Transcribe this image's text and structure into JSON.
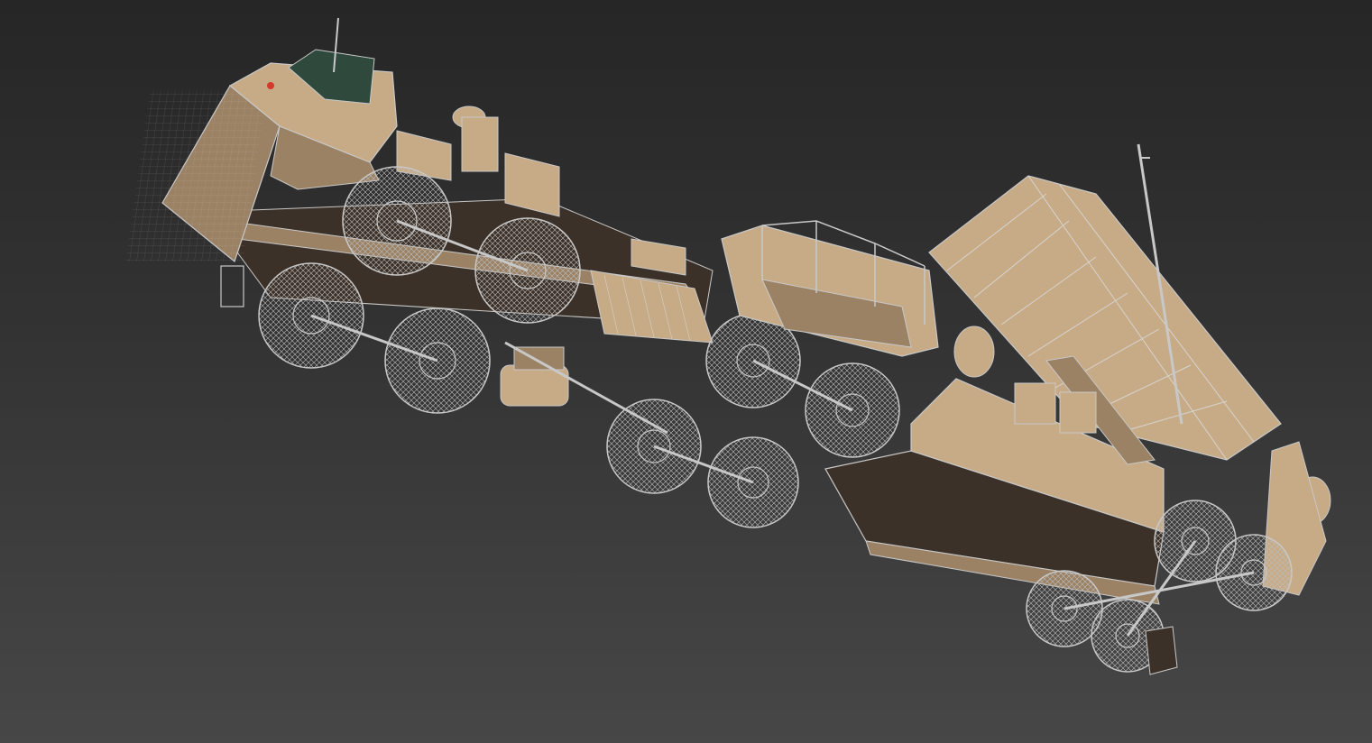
{
  "viewport": {
    "background_top": "#262626",
    "background_bottom": "#474747"
  },
  "model": {
    "wire_color": "#c8c8c8",
    "wire_color_dark": "#9a9a9a",
    "body_color": "#c7ab86",
    "body_color_shade": "#9b8265",
    "shadow_color": "#3c3128",
    "glass_color": "#2f4a3d",
    "light_color": "#d33a2b"
  }
}
